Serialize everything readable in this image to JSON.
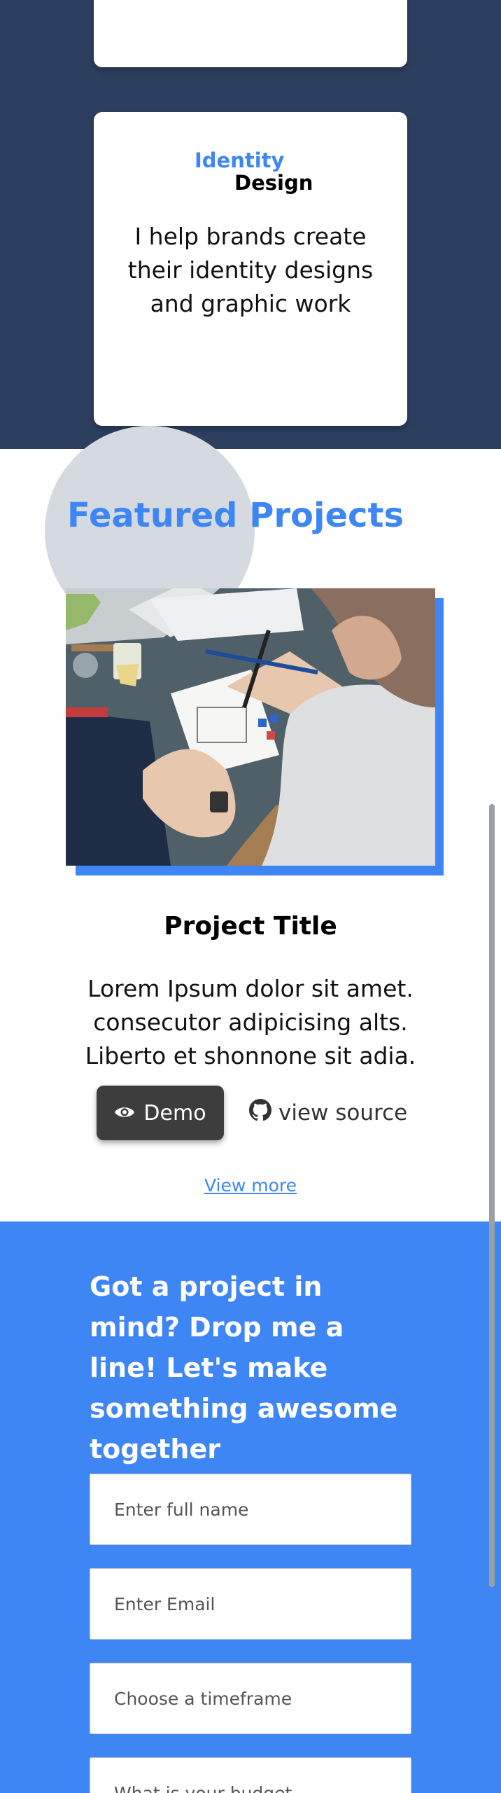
{
  "services": {
    "identity_card": {
      "brand_first": "Identity",
      "brand_second": "Design",
      "description": "I help brands create their identity designs and graphic work"
    }
  },
  "featured": {
    "title": "Featured Projects",
    "project": {
      "image_alt": "Person sketching app wireframes on paper",
      "title": "Project Title",
      "description": "Lorem Ipsum dolor sit amet. consecutor adipicising alts. Liberto et shonnone sit adia.",
      "demo_label": "Demo",
      "demo_icon": "eye-icon",
      "source_label": "view source",
      "source_icon": "github-icon"
    },
    "view_more": "View more"
  },
  "contact": {
    "heading": "Got a project in mind? Drop me a line! Let's make something awesome together",
    "fields": {
      "name_placeholder": "Enter full name",
      "email_placeholder": "Enter Email",
      "timeframe_placeholder": "Choose a timeframe",
      "budget_placeholder": "What is your budget"
    }
  },
  "colors": {
    "navy": "#2d3f5f",
    "accent": "#3f86f5",
    "button_dark": "#3d3d3d"
  }
}
